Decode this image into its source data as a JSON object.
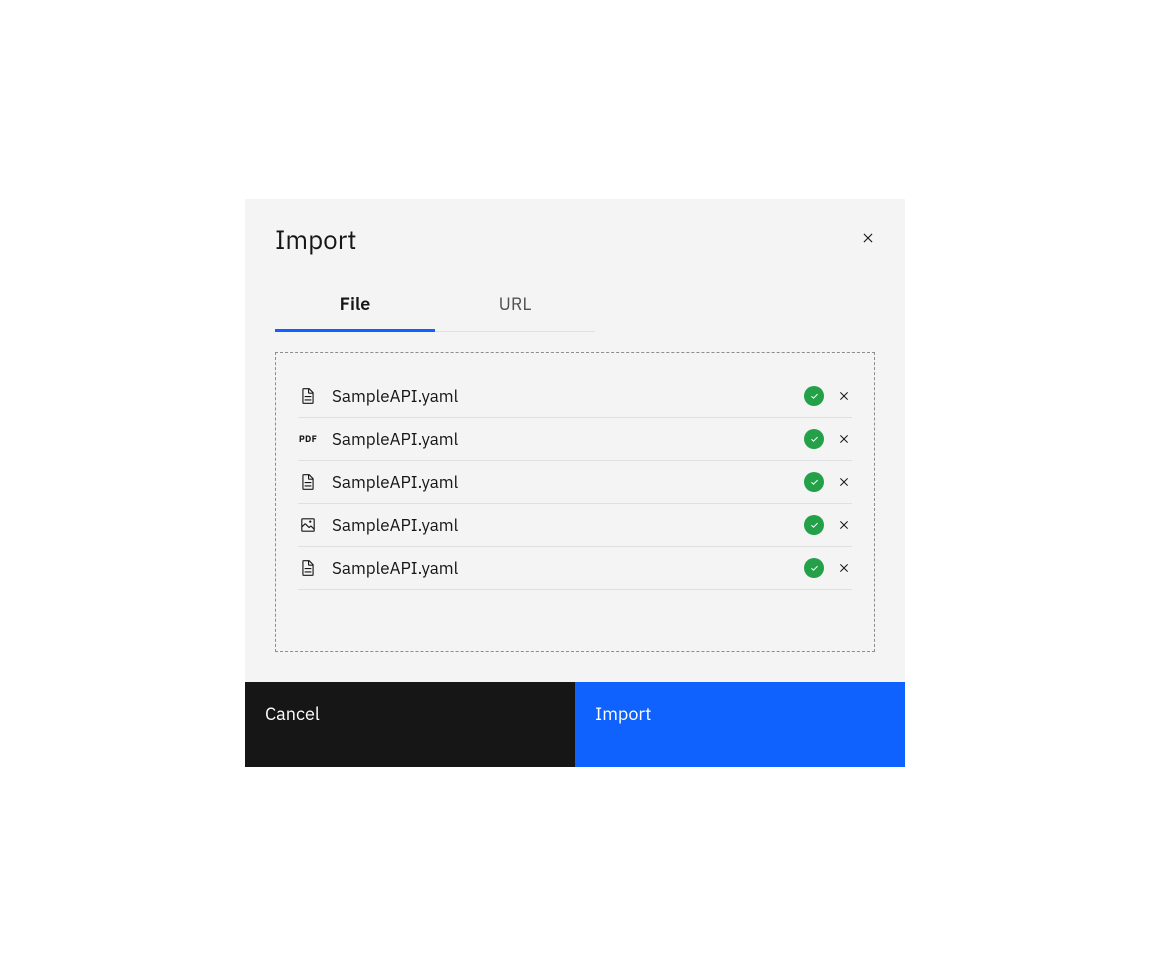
{
  "modal": {
    "title": "Import",
    "tabs": [
      {
        "label": "File",
        "active": true
      },
      {
        "label": "URL",
        "active": false
      }
    ],
    "files": [
      {
        "name": "SampleAPI.yaml",
        "icon": "document",
        "status": "success"
      },
      {
        "name": "SampleAPI.yaml",
        "icon": "pdf",
        "status": "success"
      },
      {
        "name": "SampleAPI.yaml",
        "icon": "document",
        "status": "success"
      },
      {
        "name": "SampleAPI.yaml",
        "icon": "image",
        "status": "success"
      },
      {
        "name": "SampleAPI.yaml",
        "icon": "document",
        "status": "success"
      }
    ],
    "buttons": {
      "cancel": "Cancel",
      "import": "Import"
    }
  }
}
